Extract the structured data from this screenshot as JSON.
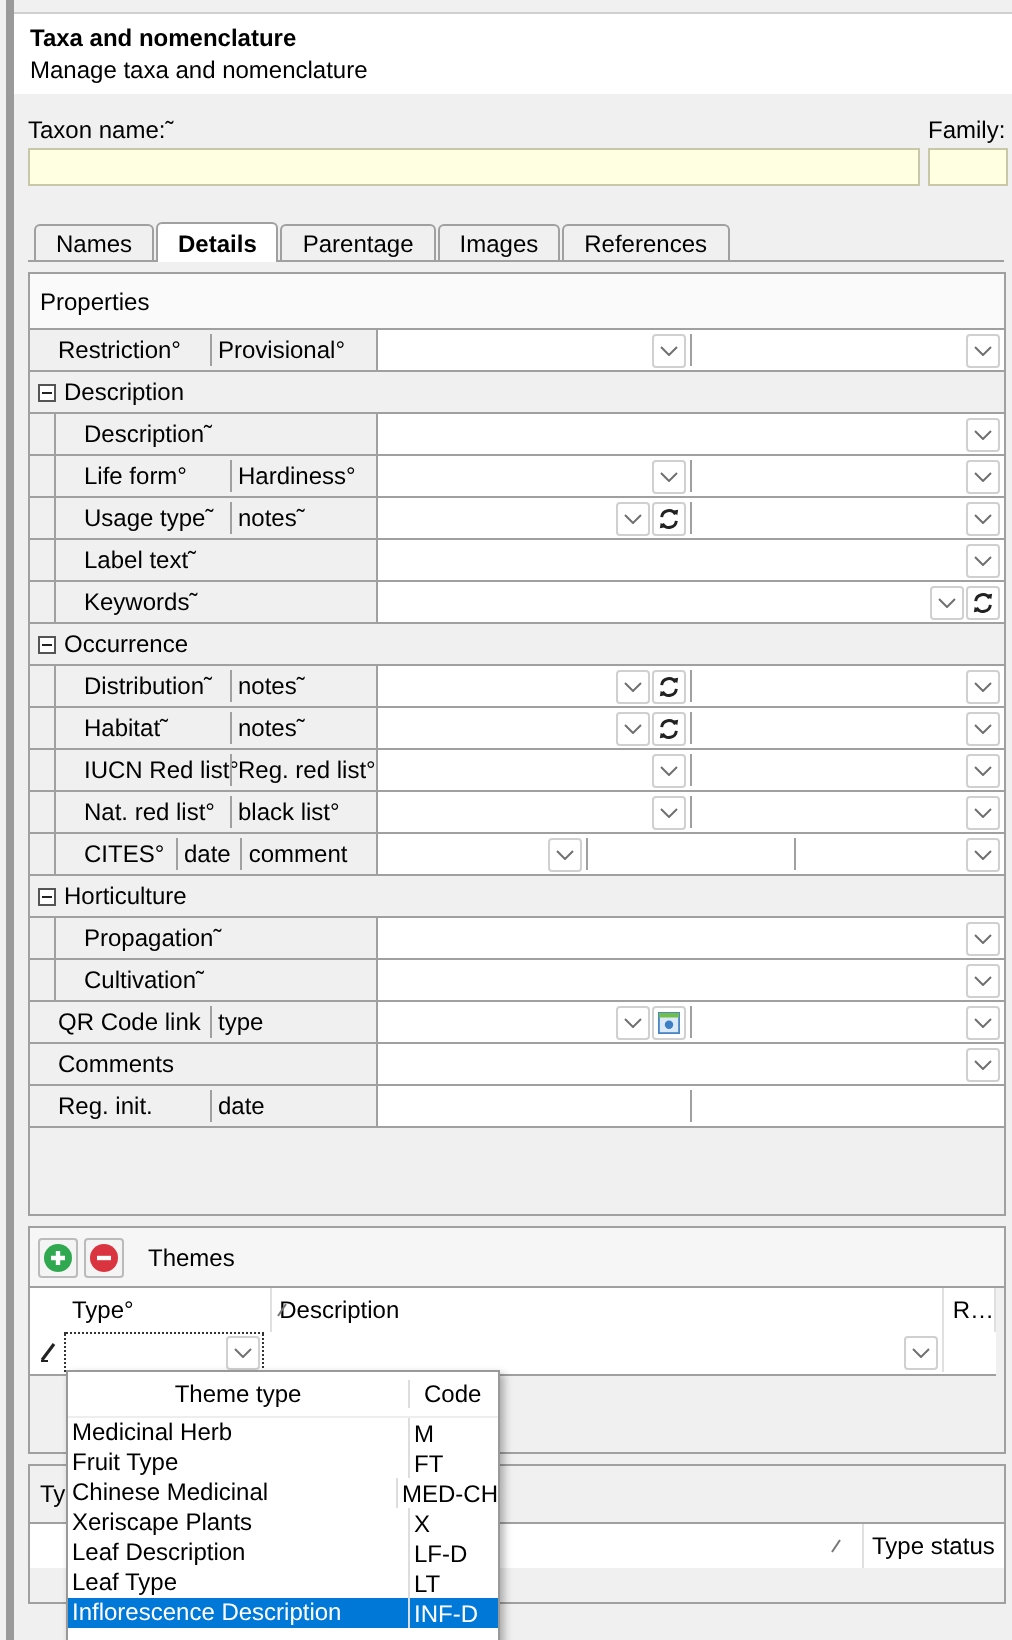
{
  "header": {
    "title": "Taxa and nomenclature",
    "subtitle": "Manage taxa and nomenclature"
  },
  "fields": [
    {
      "label": "Taxon name:˜"
    },
    {
      "label": "Family:"
    }
  ],
  "tabs": [
    {
      "label": "Names",
      "selected": false
    },
    {
      "label": "Details",
      "selected": true
    },
    {
      "label": "Parentage",
      "selected": false
    },
    {
      "label": "Images",
      "selected": false
    },
    {
      "label": "References",
      "selected": false
    }
  ],
  "properties": {
    "title": "Properties",
    "rows": [
      {
        "kind": "field",
        "labels": [
          "Restriction°",
          "Provisional°"
        ],
        "editors": [
          {
            "kind": "combo"
          },
          {
            "kind": "combo"
          }
        ]
      },
      {
        "kind": "group",
        "label": "Description",
        "expanded": true,
        "children": [
          {
            "kind": "field",
            "labels": [
              "Description˜"
            ],
            "editors": [
              {
                "kind": "combo"
              }
            ]
          },
          {
            "kind": "field",
            "labels": [
              "Life form°",
              "Hardiness°"
            ],
            "editors": [
              {
                "kind": "combo"
              },
              {
                "kind": "combo"
              }
            ]
          },
          {
            "kind": "field",
            "labels": [
              "Usage type˜",
              "notes˜"
            ],
            "editors": [
              {
                "kind": "combo-refresh"
              },
              {
                "kind": "combo"
              }
            ]
          },
          {
            "kind": "field",
            "labels": [
              "Label text˜"
            ],
            "editors": [
              {
                "kind": "combo"
              }
            ]
          },
          {
            "kind": "field",
            "labels": [
              "Keywords˜"
            ],
            "editors": [
              {
                "kind": "combo-refresh"
              }
            ]
          }
        ]
      },
      {
        "kind": "group",
        "label": "Occurrence",
        "expanded": true,
        "children": [
          {
            "kind": "field",
            "labels": [
              "Distribution˜",
              "notes˜"
            ],
            "editors": [
              {
                "kind": "combo-refresh"
              },
              {
                "kind": "combo"
              }
            ]
          },
          {
            "kind": "field",
            "labels": [
              "Habitat˜",
              "notes˜"
            ],
            "editors": [
              {
                "kind": "combo-refresh"
              },
              {
                "kind": "combo"
              }
            ]
          },
          {
            "kind": "field",
            "labels": [
              "IUCN Red list°",
              "Reg. red list°"
            ],
            "editors": [
              {
                "kind": "combo"
              },
              {
                "kind": "combo"
              }
            ]
          },
          {
            "kind": "field",
            "labels": [
              "Nat. red list°",
              "black list°"
            ],
            "editors": [
              {
                "kind": "combo"
              },
              {
                "kind": "combo"
              }
            ]
          },
          {
            "kind": "field",
            "labels": [
              "CITES°",
              "date",
              "comment"
            ],
            "editors": [
              {
                "kind": "combo"
              },
              {
                "kind": "text"
              },
              {
                "kind": "combo"
              }
            ]
          }
        ]
      },
      {
        "kind": "group",
        "label": "Horticulture",
        "expanded": true,
        "children": [
          {
            "kind": "field",
            "labels": [
              "Propagation˜"
            ],
            "editors": [
              {
                "kind": "combo"
              }
            ]
          },
          {
            "kind": "field",
            "labels": [
              "Cultivation˜"
            ],
            "editors": [
              {
                "kind": "combo"
              }
            ]
          }
        ]
      },
      {
        "kind": "field",
        "labels": [
          "QR Code link",
          "type"
        ],
        "editors": [
          {
            "kind": "combo-image"
          },
          {
            "kind": "combo"
          }
        ]
      },
      {
        "kind": "field",
        "labels": [
          "Comments"
        ],
        "editors": [
          {
            "kind": "combo"
          }
        ]
      },
      {
        "kind": "field",
        "labels": [
          "Reg. init.",
          "date"
        ],
        "editors": [
          {
            "kind": "text"
          },
          {
            "kind": "text"
          }
        ]
      }
    ]
  },
  "themes": {
    "title": "Themes",
    "columns": [
      "Type°",
      "Description",
      "R…"
    ]
  },
  "types_panel": {
    "title": "Ty",
    "columns": [
      "Type status"
    ]
  },
  "dropdown": {
    "columns": [
      "Theme type",
      "Code"
    ],
    "items": [
      {
        "name": "Medicinal Herb",
        "code": "M",
        "selected": false
      },
      {
        "name": "Fruit Type",
        "code": "FT",
        "selected": false
      },
      {
        "name": "Chinese Medicinal",
        "code": "MED-CH",
        "selected": false
      },
      {
        "name": "Xeriscape Plants",
        "code": "X",
        "selected": false
      },
      {
        "name": "Leaf Description",
        "code": "LF-D",
        "selected": false
      },
      {
        "name": "Leaf Type",
        "code": "LT",
        "selected": false
      },
      {
        "name": "Inflorescence Description",
        "code": "INF-D",
        "selected": true
      }
    ]
  }
}
